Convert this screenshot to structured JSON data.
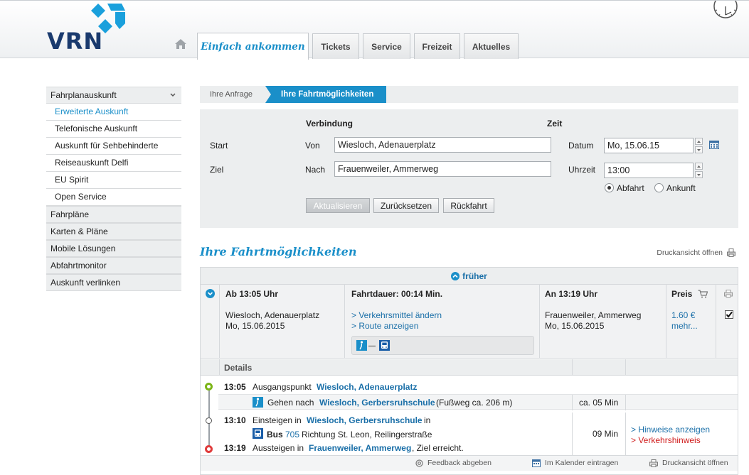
{
  "header": {
    "logo_text": "VRN",
    "nav_tabs": [
      "Einfach ankommen",
      "Tickets",
      "Service",
      "Freizeit",
      "Aktuelles"
    ]
  },
  "sidebar": {
    "main_open": "Fahrplanauskunft",
    "sub_items": [
      "Erweiterte Auskunft",
      "Telefonische Auskunft",
      "Auskunft für Sehbehinderte",
      "Reiseauskunft Delfi",
      "EU Spirit",
      "Open Service"
    ],
    "main_items": [
      "Fahrpläne",
      "Karten & Pläne",
      "Mobile Lösungen",
      "Abfahrtmonitor",
      "Auskunft verlinken"
    ]
  },
  "breadcrumb": {
    "step1": "Ihre Anfrage",
    "step2": "Ihre Fahrtmöglichkeiten"
  },
  "form": {
    "verbindung": "Verbindung",
    "zeit": "Zeit",
    "start": "Start",
    "ziel": "Ziel",
    "von": "Von",
    "nach": "Nach",
    "von_value": "Wiesloch, Adenauerplatz",
    "nach_value": "Frauenweiler, Ammerweg",
    "datum_label": "Datum",
    "datum_value": "Mo, 15.06.15",
    "uhrzeit_label": "Uhrzeit",
    "uhrzeit_value": "13:00",
    "abfahrt": "Abfahrt",
    "ankunft": "Ankunft",
    "btn_update": "Aktualisieren",
    "btn_reset": "Zurücksetzen",
    "btn_return": "Rückfahrt"
  },
  "results": {
    "title": "Ihre Fahrtmöglichkeiten",
    "print": "Druckansicht öffnen",
    "earlier": "früher",
    "connection": {
      "dep_head": "Ab 13:05 Uhr",
      "dep_stop": "Wiesloch, Adenauerplatz",
      "dep_date": "Mo, 15.06.2015",
      "duration_head": "Fahrtdauer: 00:14 Min.",
      "link_modes": "> Verkehrsmittel ändern",
      "link_route": "> Route anzeigen",
      "arr_head": "An 13:19 Uhr",
      "arr_stop": "Frauenweiler, Ammerweg",
      "arr_date": "Mo, 15.06.2015",
      "price_head": "Preis",
      "price": "1.60 €",
      "more": "mehr..."
    },
    "details": {
      "head": "Details",
      "r1_time": "13:05",
      "r1_text": "Ausgangspunkt",
      "r1_stop": "Wiesloch, Adenauerplatz",
      "walk_text": "Gehen nach",
      "walk_stop": "Wiesloch, Gerbersruhschule",
      "walk_info": "(Fußweg ca. 206 m)",
      "walk_dur": "ca. 05 Min",
      "r2_time": "13:10",
      "r2_text": "Einsteigen in",
      "r2_stop": "Wiesloch, Gerbersruhschule",
      "r2_in": "in",
      "bus_label": "Bus",
      "bus_line": "705",
      "bus_dir": "Richtung St. Leon, Reilingerstraße",
      "bus_dur": "09 Min",
      "hints": "> Hinweise anzeigen",
      "traffic": "> Verkehrshinweis",
      "r3_time": "13:19",
      "r3_text": "Aussteigen in",
      "r3_stop": "Frauenweiler, Ammerweg",
      "r3_end": ", Ziel erreicht."
    },
    "footer": {
      "feedback": "Feedback abgeben",
      "calendar": "Im Kalender eintragen",
      "print": "Druckansicht öffnen"
    }
  },
  "colors": {
    "accent": "#1a8fc9",
    "brand_dark": "#1a3a6e",
    "link": "#1a6fa8",
    "alert": "#d01d1d"
  }
}
